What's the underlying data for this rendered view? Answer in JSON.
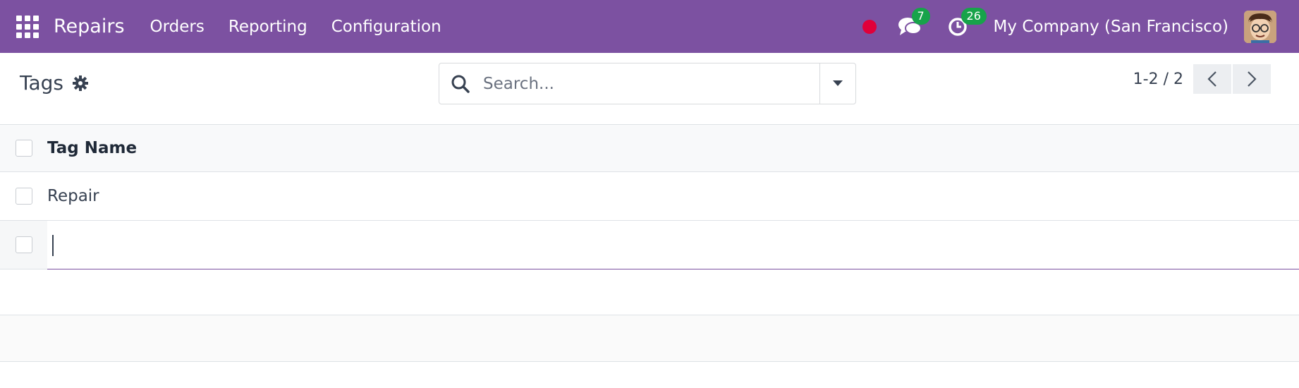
{
  "navbar": {
    "app_name": "Repairs",
    "menu": [
      {
        "label": "Orders"
      },
      {
        "label": "Reporting"
      },
      {
        "label": "Configuration"
      }
    ],
    "messages_count": "7",
    "activities_count": "26",
    "company": "My Company (San Francisco)",
    "colors": {
      "bar": "#7c51a1",
      "badge": "#17a34a",
      "record_dot": "#e0003a"
    }
  },
  "control_panel": {
    "title": "Tags",
    "search_placeholder": "Search...",
    "pager": "1-2 / 2"
  },
  "list": {
    "column_header": "Tag Name",
    "rows": [
      {
        "name": "Repair"
      }
    ],
    "new_row_value": ""
  },
  "icons": {
    "apps": "apps-grid-icon",
    "messages": "chat-bubbles-icon",
    "activities": "clock-icon",
    "settings": "gear-icon",
    "search": "search-icon",
    "toggle": "caret-down-icon",
    "prev": "chevron-left-icon",
    "next": "chevron-right-icon"
  }
}
